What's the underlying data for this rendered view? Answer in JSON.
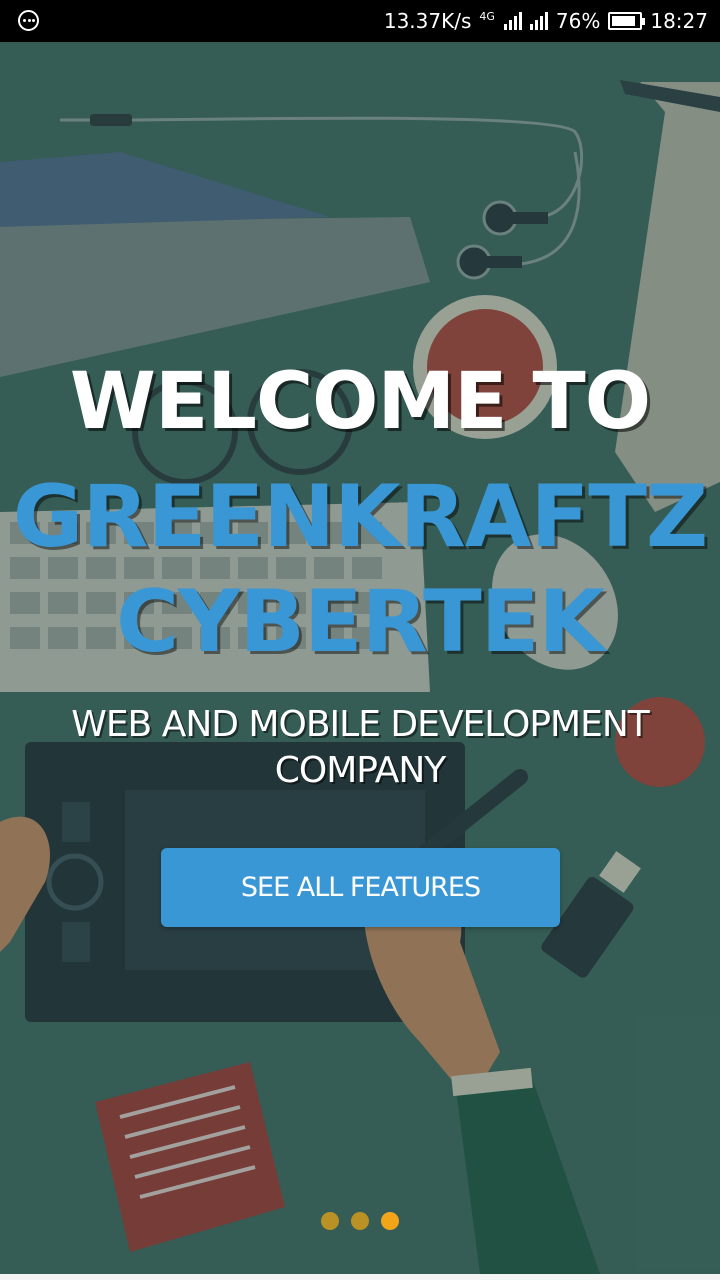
{
  "status_bar": {
    "speed": "13.37K/s",
    "network": "4G",
    "battery": "76%",
    "time": "18:27"
  },
  "hero": {
    "line1": "WELCOME TO",
    "line2": "GREENKRAFTZ",
    "line3": "CYBERTEK",
    "subtitle": "WEB AND MOBILE DEVELOPMENT COMPANY",
    "cta_label": "SEE ALL FEATURES"
  },
  "pager": {
    "count": 3,
    "active_index": 2
  },
  "colors": {
    "accent_blue": "#3a97d6",
    "background_green": "#3d6a61",
    "dot_inactive": "#b99124",
    "dot_active": "#f3a51a"
  }
}
